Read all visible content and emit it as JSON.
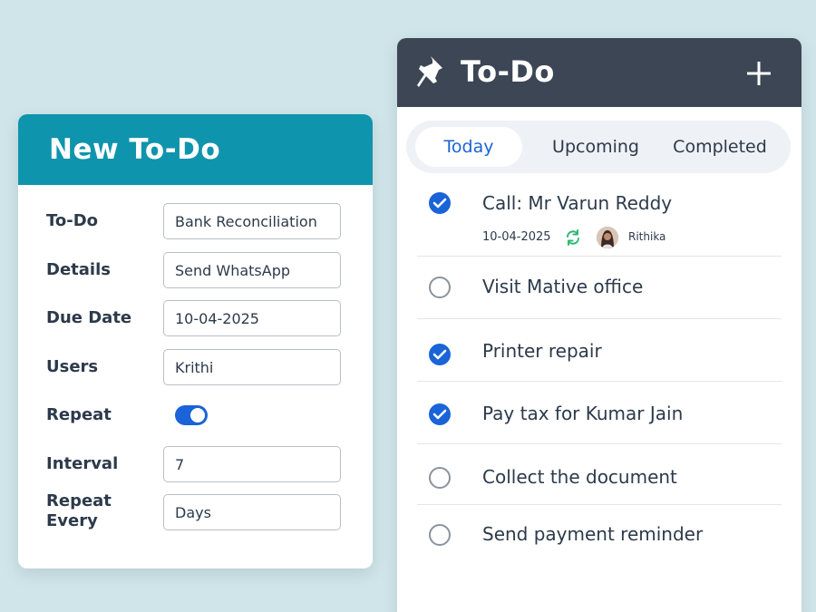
{
  "new_todo": {
    "title": "New To-Do",
    "fields": {
      "todo": {
        "label": "To-Do",
        "value": "Bank Reconciliation"
      },
      "details": {
        "label": "Details",
        "value": "Send WhatsApp"
      },
      "due_date": {
        "label": "Due Date",
        "value": "10-04-2025"
      },
      "users": {
        "label": "Users",
        "value": "Krithi"
      },
      "repeat": {
        "label": "Repeat",
        "on": true
      },
      "interval": {
        "label": "Interval",
        "value": "7"
      },
      "repeat_every": {
        "label_line1": "Repeat",
        "label_line2": "Every",
        "value": "Days"
      }
    }
  },
  "todo_panel": {
    "title": "To-Do",
    "tabs": [
      {
        "label": "Today",
        "active": true
      },
      {
        "label": "Upcoming",
        "active": false
      },
      {
        "label": "Completed",
        "active": false
      }
    ],
    "tasks": [
      {
        "title": "Call: Mr Varun Reddy",
        "done": true,
        "date": "10-04-2025",
        "user": "Rithika"
      },
      {
        "title": "Visit Mative office",
        "done": false
      },
      {
        "title": "Printer repair",
        "done": true
      },
      {
        "title": "Pay tax for Kumar Jain",
        "done": true
      },
      {
        "title": "Collect the document",
        "done": false
      },
      {
        "title": "Send payment reminder",
        "done": false
      }
    ]
  },
  "colors": {
    "background": "#cfe5ea",
    "form_header": "#0f94ad",
    "panel_header": "#3c4655",
    "accent_blue": "#1a63d8",
    "repeat_green": "#2eb872"
  }
}
